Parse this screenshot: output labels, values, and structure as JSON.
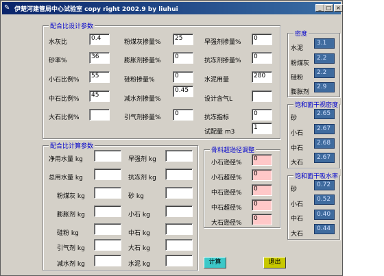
{
  "window": {
    "title": "伊楚河建管局中心试验室 copy right 2002.9 by liuhui",
    "icon": "pen-icon",
    "controls": [
      "_",
      "□",
      "×"
    ]
  },
  "design_params": {
    "title": "配合比设计参数",
    "col1": [
      {
        "label": "水灰比",
        "value": "0.4"
      },
      {
        "label": "砂率%",
        "value": "36"
      },
      {
        "label": "小石比例%",
        "value": "55"
      },
      {
        "label": "中石比例%",
        "value": "45"
      },
      {
        "label": "大石比例%",
        "value": ""
      }
    ],
    "col2": [
      {
        "label": "粉煤灰掺量%",
        "value": "25"
      },
      {
        "label": "膨胀剂掺量%",
        "value": "0"
      },
      {
        "label": "硅粉掺量%",
        "value": "0"
      },
      {
        "label": "减水剂掺量%",
        "value": "0.45"
      },
      {
        "label": "引气剂掺量%",
        "value": "0"
      }
    ],
    "col3": [
      {
        "label": "早强剂掺量%",
        "value": "0"
      },
      {
        "label": "抗冻剂掺量%",
        "value": "0"
      },
      {
        "label": "水泥用量",
        "value": "280"
      },
      {
        "label": "设计含气L",
        "value": ""
      },
      {
        "label": "抗冻指标",
        "value": "0"
      },
      {
        "label": "试配量 m3",
        "value": "1"
      }
    ]
  },
  "calc_params": {
    "title": "配合比计算参数",
    "col1": [
      {
        "label": "净用水量 kg",
        "value": ""
      },
      {
        "label": "总用水量 kg",
        "value": ""
      },
      {
        "label": "粉煤灰 kg",
        "value": ""
      },
      {
        "label": "膨胀剂 kg",
        "value": ""
      },
      {
        "label": "硅粉 kg",
        "value": ""
      },
      {
        "label": "引气剂 kg",
        "value": ""
      },
      {
        "label": "减水剂 kg",
        "value": ""
      }
    ],
    "col2": [
      {
        "label": "早强剂 kg",
        "value": ""
      },
      {
        "label": "抗冻剂 kg",
        "value": ""
      },
      {
        "label": "砂 kg",
        "value": ""
      },
      {
        "label": "小石 kg",
        "value": ""
      },
      {
        "label": "中石 kg",
        "value": ""
      },
      {
        "label": "大石 kg",
        "value": ""
      },
      {
        "label": "水泥 kg",
        "value": ""
      }
    ]
  },
  "aggregate": {
    "title": "骨料超逊径调整",
    "rows": [
      {
        "label": "小石逊径%",
        "value": "0"
      },
      {
        "label": "小石超径%",
        "value": "0"
      },
      {
        "label": "中石逊径%",
        "value": "0"
      },
      {
        "label": "中石超径%",
        "value": "0"
      },
      {
        "label": "大石逊径%",
        "value": "0"
      }
    ]
  },
  "density": {
    "title": "密度",
    "rows": [
      {
        "label": "水泥",
        "value": "3.1"
      },
      {
        "label": "粉煤灰",
        "value": "2.2"
      },
      {
        "label": "硅粉",
        "value": "2.2"
      },
      {
        "label": "膨胀剂",
        "value": "2.9"
      }
    ]
  },
  "ssd_density": {
    "title": "饱和面干视密度",
    "rows": [
      {
        "label": "砂",
        "value": "2.65"
      },
      {
        "label": "小石",
        "value": "2.67"
      },
      {
        "label": "中石",
        "value": "2.68"
      },
      {
        "label": "大石",
        "value": "2.67"
      }
    ]
  },
  "ssd_absorption": {
    "title": "饱和面干吸水率",
    "rows": [
      {
        "label": "砂",
        "value": "0.72"
      },
      {
        "label": "小石",
        "value": "0.52"
      },
      {
        "label": "中石",
        "value": "0.40"
      },
      {
        "label": "大石",
        "value": "0.44"
      }
    ]
  },
  "buttons": {
    "calculate": "计算",
    "exit": "退出"
  },
  "colors": {
    "calculate_bg": "#3cc8c8",
    "exit_bg": "#c8c800",
    "value_box_bg": "#3f6b9e",
    "pink_input": "#ffc8c8"
  }
}
